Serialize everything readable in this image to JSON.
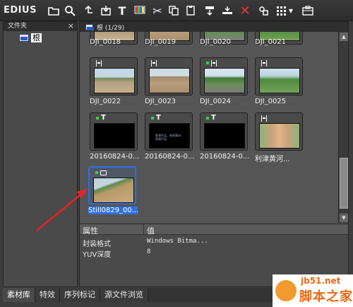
{
  "app": {
    "title": "EDIUS"
  },
  "toolbar": {
    "icons": [
      "folder-icon",
      "search-icon",
      "up-icon",
      "import-icon",
      "text-icon",
      "color-bars-icon",
      "cut-icon",
      "copy-icon",
      "paste-icon",
      "add-to-timeline-icon",
      "insert-icon",
      "delete-icon",
      "properties-icon",
      "view-mode-icon",
      "menu-arrow-icon",
      "bin-icon"
    ]
  },
  "folder_pane": {
    "title": "文件夹",
    "close": "×",
    "root_label": "根"
  },
  "bin": {
    "path": "根 (1/29)",
    "clips_top": [
      "DJI_0018",
      "DJI_0019",
      "DJI_0020",
      "DJI_0021"
    ],
    "clips_row2": [
      "DJI_0022",
      "DJI_0023",
      "DJI_0024",
      "DJI_0025"
    ],
    "clips_row3": [
      "20160824-0...",
      "20160824-0...",
      "20160824-0...",
      "利津黄河..."
    ],
    "clip_selected": "Still0829_00...",
    "black_text": "影视作品、新闻素材、视频片段"
  },
  "properties": {
    "header_key": "属性",
    "header_value": "值",
    "rows": [
      {
        "key": "封装格式",
        "value": "Windows Bitma..."
      },
      {
        "key": "YUV深度",
        "value": "8"
      }
    ]
  },
  "tabs": [
    "素材库",
    "特效",
    "序列标记",
    "源文件浏览"
  ],
  "watermark": {
    "url": "jb51.net",
    "text": "脚本之家"
  },
  "colors": {
    "selection": "#2f6fe0",
    "arrow": "#e0242a",
    "watermark": "#e86a17"
  }
}
